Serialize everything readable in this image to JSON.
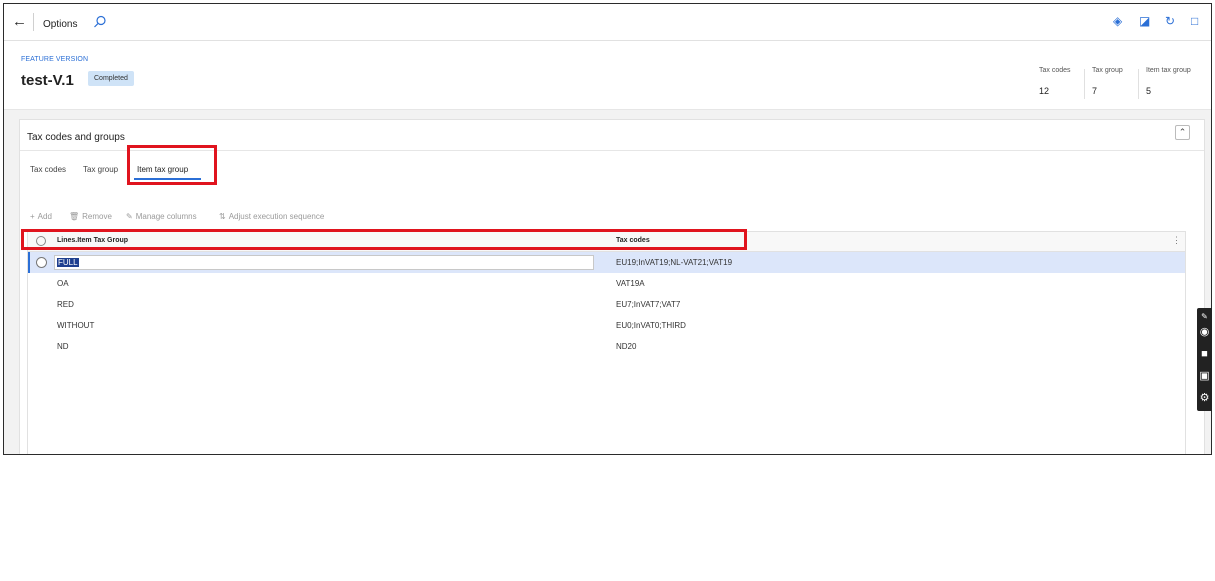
{
  "topbar": {
    "back_icon": "back-arrow-icon",
    "title": "Options",
    "search_icon": "search-icon",
    "right_icons": [
      "diamond-icon",
      "office-icon",
      "refresh-icon",
      "popout-icon"
    ]
  },
  "header": {
    "caption": "FEATURE VERSION",
    "title": "test-V.1",
    "status": "Completed",
    "stats": [
      {
        "label": "Tax codes",
        "value": "12"
      },
      {
        "label": "Tax group",
        "value": "7"
      },
      {
        "label": "Item tax group",
        "value": "5"
      }
    ]
  },
  "card": {
    "title": "Tax codes and groups",
    "collapse_icon": "chevron-up-icon",
    "tabs": [
      "Tax codes",
      "Tax group",
      "Item tax group"
    ],
    "active_tab": "Item tax group",
    "toolbar": {
      "add": "Add",
      "remove": "Remove",
      "manage_columns": "Manage columns",
      "adjust": "Adjust execution sequence"
    }
  },
  "grid": {
    "columns": [
      "Lines.Item Tax Group",
      "Tax codes"
    ],
    "rows": [
      {
        "group": "FULL",
        "codes": "EU19;InVAT19;NL-VAT21;VAT19",
        "selected": true
      },
      {
        "group": "OA",
        "codes": "VAT19A",
        "selected": false
      },
      {
        "group": "RED",
        "codes": "EU7;InVAT7;VAT7",
        "selected": false
      },
      {
        "group": "WITHOUT",
        "codes": "EU0;InVAT0;THIRD",
        "selected": false
      },
      {
        "group": "ND",
        "codes": "ND20",
        "selected": false
      }
    ]
  },
  "colors": {
    "accent": "#2b6fd6",
    "annotation": "#e0141e",
    "selected_row": "#dce6fa"
  }
}
